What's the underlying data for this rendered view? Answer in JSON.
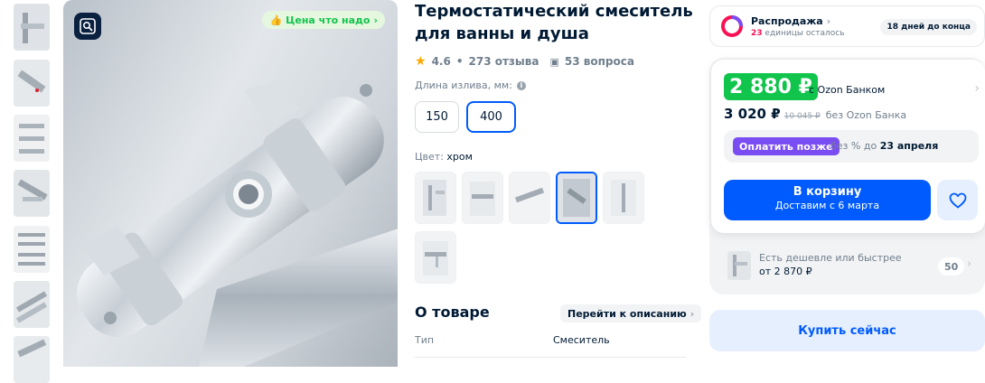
{
  "gallery": {
    "badge_label": "Цена что надо",
    "badge_icon": "thumbs-up-icon",
    "lens_icon": "image-search-icon",
    "thumbnails": [
      "thumb-1",
      "thumb-2",
      "thumb-3",
      "thumb-4",
      "thumb-5",
      "thumb-6",
      "thumb-7"
    ]
  },
  "product": {
    "title_line1": "Термостатический смеситель",
    "title_line2": "для ванны и душа",
    "rating": "4.6",
    "reviews": "273 отзыва",
    "questions": "53 вопроса",
    "spout_label": "Длина излива, мм:",
    "spout_options": [
      "150",
      "400"
    ],
    "spout_selected": "400",
    "color_label": "Цвет:",
    "color_value": "хром",
    "color_swatch_count": 6,
    "about_title": "О товаре",
    "goto_description": "Перейти к описанию",
    "specs": [
      {
        "key": "Тип",
        "value": "Смеситель"
      }
    ]
  },
  "offer": {
    "sale_title": "Распродажа",
    "sale_count": "23",
    "sale_left": "единицы осталось",
    "sale_days": "18 дней до конца",
    "price_bank": "2 880 ₽",
    "with_bank": "с Ozon Банком",
    "price_regular": "3 020 ₽",
    "price_old": "10 045 ₽",
    "without_bank": "без Ozon Банка",
    "pay_later_button": "Оплатить позже",
    "pay_later_prefix": "без % до",
    "pay_later_date": "23 апреля",
    "cart_label": "В корзину",
    "cart_delivery": "Доставим с 6 марта",
    "alt_title": "Есть дешевле или быстрее",
    "alt_price": "от 2 870 ₽",
    "alt_count": "50",
    "buy_now": "Купить сейчас"
  },
  "colors": {
    "primary": "#005bff",
    "green": "#10c44c",
    "purple": "#7a4df2",
    "pink": "#f91155",
    "text": "#001a34",
    "muted": "#707f8d"
  }
}
